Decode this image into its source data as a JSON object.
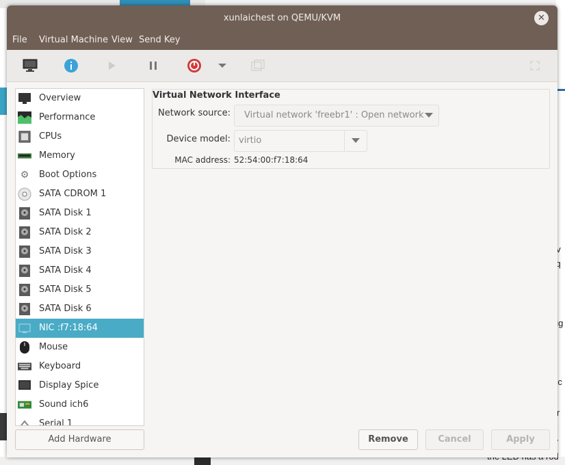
{
  "window": {
    "title": "xunlaichest on QEMU/KVM"
  },
  "menu": [
    "File",
    "Virtual Machine",
    "View",
    "Send Key"
  ],
  "toolbar": {
    "buttons": [
      "monitor-icon",
      "info-icon",
      "play-icon",
      "pause-icon",
      "power-icon",
      "chevron-down-icon",
      "screenshot-icon",
      "fullscreen-icon"
    ]
  },
  "sidebar": {
    "items": [
      {
        "label": "Overview",
        "icon": "monitor-icon"
      },
      {
        "label": "Performance",
        "icon": "chart-icon"
      },
      {
        "label": "CPUs",
        "icon": "cpu-icon"
      },
      {
        "label": "Memory",
        "icon": "memory-icon"
      },
      {
        "label": "Boot Options",
        "icon": "gear-icon"
      },
      {
        "label": "SATA CDROM 1",
        "icon": "cdrom-icon"
      },
      {
        "label": "SATA Disk 1",
        "icon": "disk-icon"
      },
      {
        "label": "SATA Disk 2",
        "icon": "disk-icon"
      },
      {
        "label": "SATA Disk 3",
        "icon": "disk-icon"
      },
      {
        "label": "SATA Disk 4",
        "icon": "disk-icon"
      },
      {
        "label": "SATA Disk 5",
        "icon": "disk-icon"
      },
      {
        "label": "SATA Disk 6",
        "icon": "disk-icon"
      },
      {
        "label": "NIC :f7:18:64",
        "icon": "network-icon",
        "selected": true
      },
      {
        "label": "Mouse",
        "icon": "mouse-icon"
      },
      {
        "label": "Keyboard",
        "icon": "keyboard-icon"
      },
      {
        "label": "Display Spice",
        "icon": "display-icon"
      },
      {
        "label": "Sound ich6",
        "icon": "sound-icon"
      },
      {
        "label": "Serial 1",
        "icon": "serial-icon"
      }
    ],
    "add_hardware": "Add Hardware"
  },
  "details": {
    "title": "Virtual Network Interface",
    "network_source_label": "Network source:",
    "network_source_value": "Virtual network 'freebr1' : Open network",
    "device_model_label": "Device model:",
    "device_model_value": "virtio",
    "mac_label": "MAC address:",
    "mac_value": "52:54:00:f7:18:64"
  },
  "buttons": {
    "remove": "Remove",
    "cancel": "Cancel",
    "apply": "Apply"
  },
  "background": {
    "right_fragments": [
      "v",
      "s",
      "ov",
      "sq",
      "e",
      "eig",
      "vic",
      "Fr",
      "tv"
    ],
    "bottom_text": "the LED has a rod"
  },
  "colors": {
    "titlebar": "#6f5f55",
    "selection": "#4aabc6",
    "accent_info": "#3aa3d8",
    "power": "#d23b3b"
  }
}
